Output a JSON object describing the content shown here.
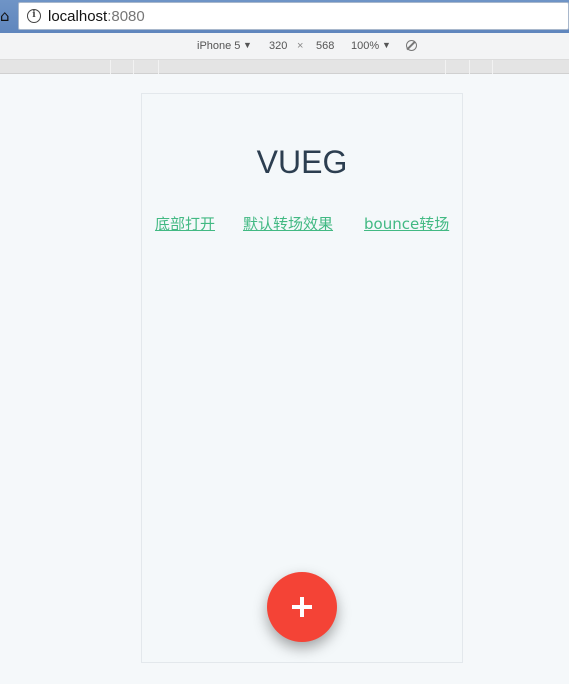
{
  "browser": {
    "url_host": "localhost",
    "url_port": ":8080",
    "info_icon_glyph": "i",
    "home_icon_glyph": "⌂"
  },
  "devtools": {
    "device": "iPhone 5",
    "device_caret": "▼",
    "width": "320",
    "times": "×",
    "height": "568",
    "zoom": "100%",
    "zoom_caret": "▼"
  },
  "app": {
    "title": "VUEG",
    "links": [
      {
        "label": "底部打开"
      },
      {
        "label": "默认转场效果"
      },
      {
        "label": "bounce转场"
      }
    ],
    "fab_color": "#f44336",
    "link_color": "#42b983",
    "title_color": "#2c3e50"
  }
}
